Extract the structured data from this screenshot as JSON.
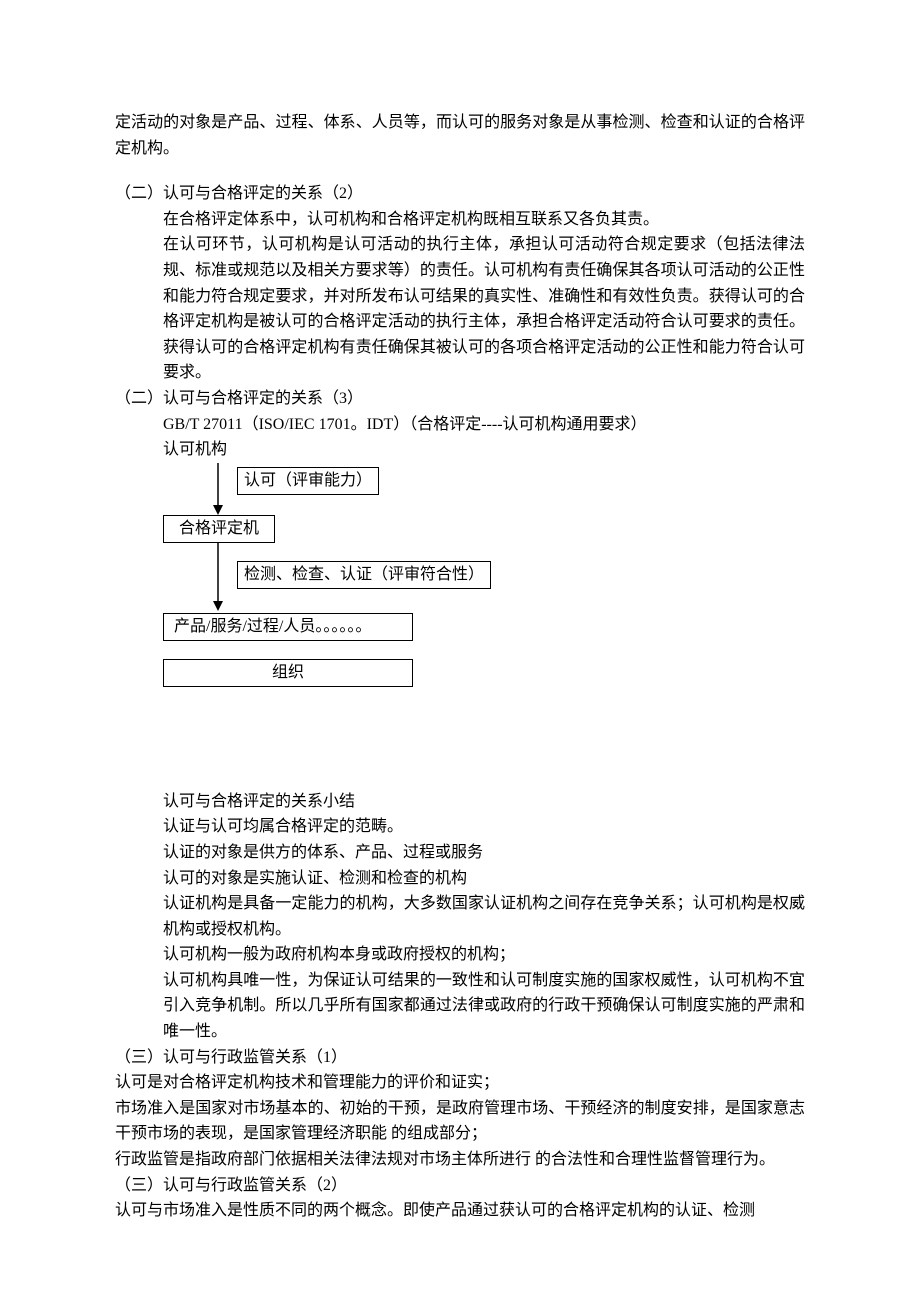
{
  "p1": "定活动的对象是产品、过程、体系、人员等，而认可的服务对象是从事检测、检查和认证的合格评定机构。",
  "h2": "（二）认可与合格评定的关系（2）",
  "p2a": "在合格评定体系中，认可机构和合格评定机构既相互联系又各负其责。",
  "p2b": "在认可环节，认可机构是认可活动的执行主体，承担认可活动符合规定要求（包括法律法规、标准或规范以及相关方要求等）的责任。认可机构有责任确保其各项认可活动的公正性和能力符合规定要求，并对所发布认可结果的真实性、准确性和有效性负责。获得认可的合格评定机构是被认可的合格评定活动的执行主体，承担合格评定活动符合认可要求的责任。获得认可的合格评定机构有责任确保其被认可的各项合格评定活动的公正性和能力符合认可要求。",
  "h3": "（二）认可与合格评定的关系（3）",
  "p3a": "GB/T 27011（ISO/IEC 1701。IDT）（合格评定----认可机构通用要求）",
  "p3b": "认可机构",
  "diagram": {
    "box1": "认可（评审能力）",
    "box2": "合格评定机",
    "box3": "检测、检查、认证（评审符合性）",
    "box4": "产品/服务/过程/人员。。。。。。",
    "box5": "组织"
  },
  "summaryHeading": "认可与合格评定的关系小结",
  "s1": "认证与认可均属合格评定的范畴。",
  "s2": "认证的对象是供方的体系、产品、过程或服务",
  "s3": "认可的对象是实施认证、检测和检查的机构",
  "s4": "认证机构是具备一定能力的机构，大多数国家认证机构之间存在竞争关系；认可机构是权威机构或授权机构。",
  "s5": "认可机构一般为政府机构本身或政府授权的机构；",
  "s6": "认可机构具唯一性，为保证认可结果的一致性和认可制度实施的国家权威性，认可机构不宜引入竞争机制。所以几乎所有国家都通过法律或政府的行政干预确保认可制度实施的严肃和唯一性。",
  "h4": "（三）认可与行政监管关系（1）",
  "p4a": "认可是对合格评定机构技术和管理能力的评价和证实；",
  "p4b": "市场准入是国家对市场基本的、初始的干预，是政府管理市场、干预经济的制度安排，是国家意志干预市场的表现，是国家管理经济职能 的组成部分；",
  "p4c": "行政监管是指政府部门依据相关法律法规对市场主体所进行 的合法性和合理性监督管理行为。",
  "h5": "（三）认可与行政监管关系（2）",
  "p5a": "认可与市场准入是性质不同的两个概念。即使产品通过获认可的合格评定机构的认证、检测"
}
